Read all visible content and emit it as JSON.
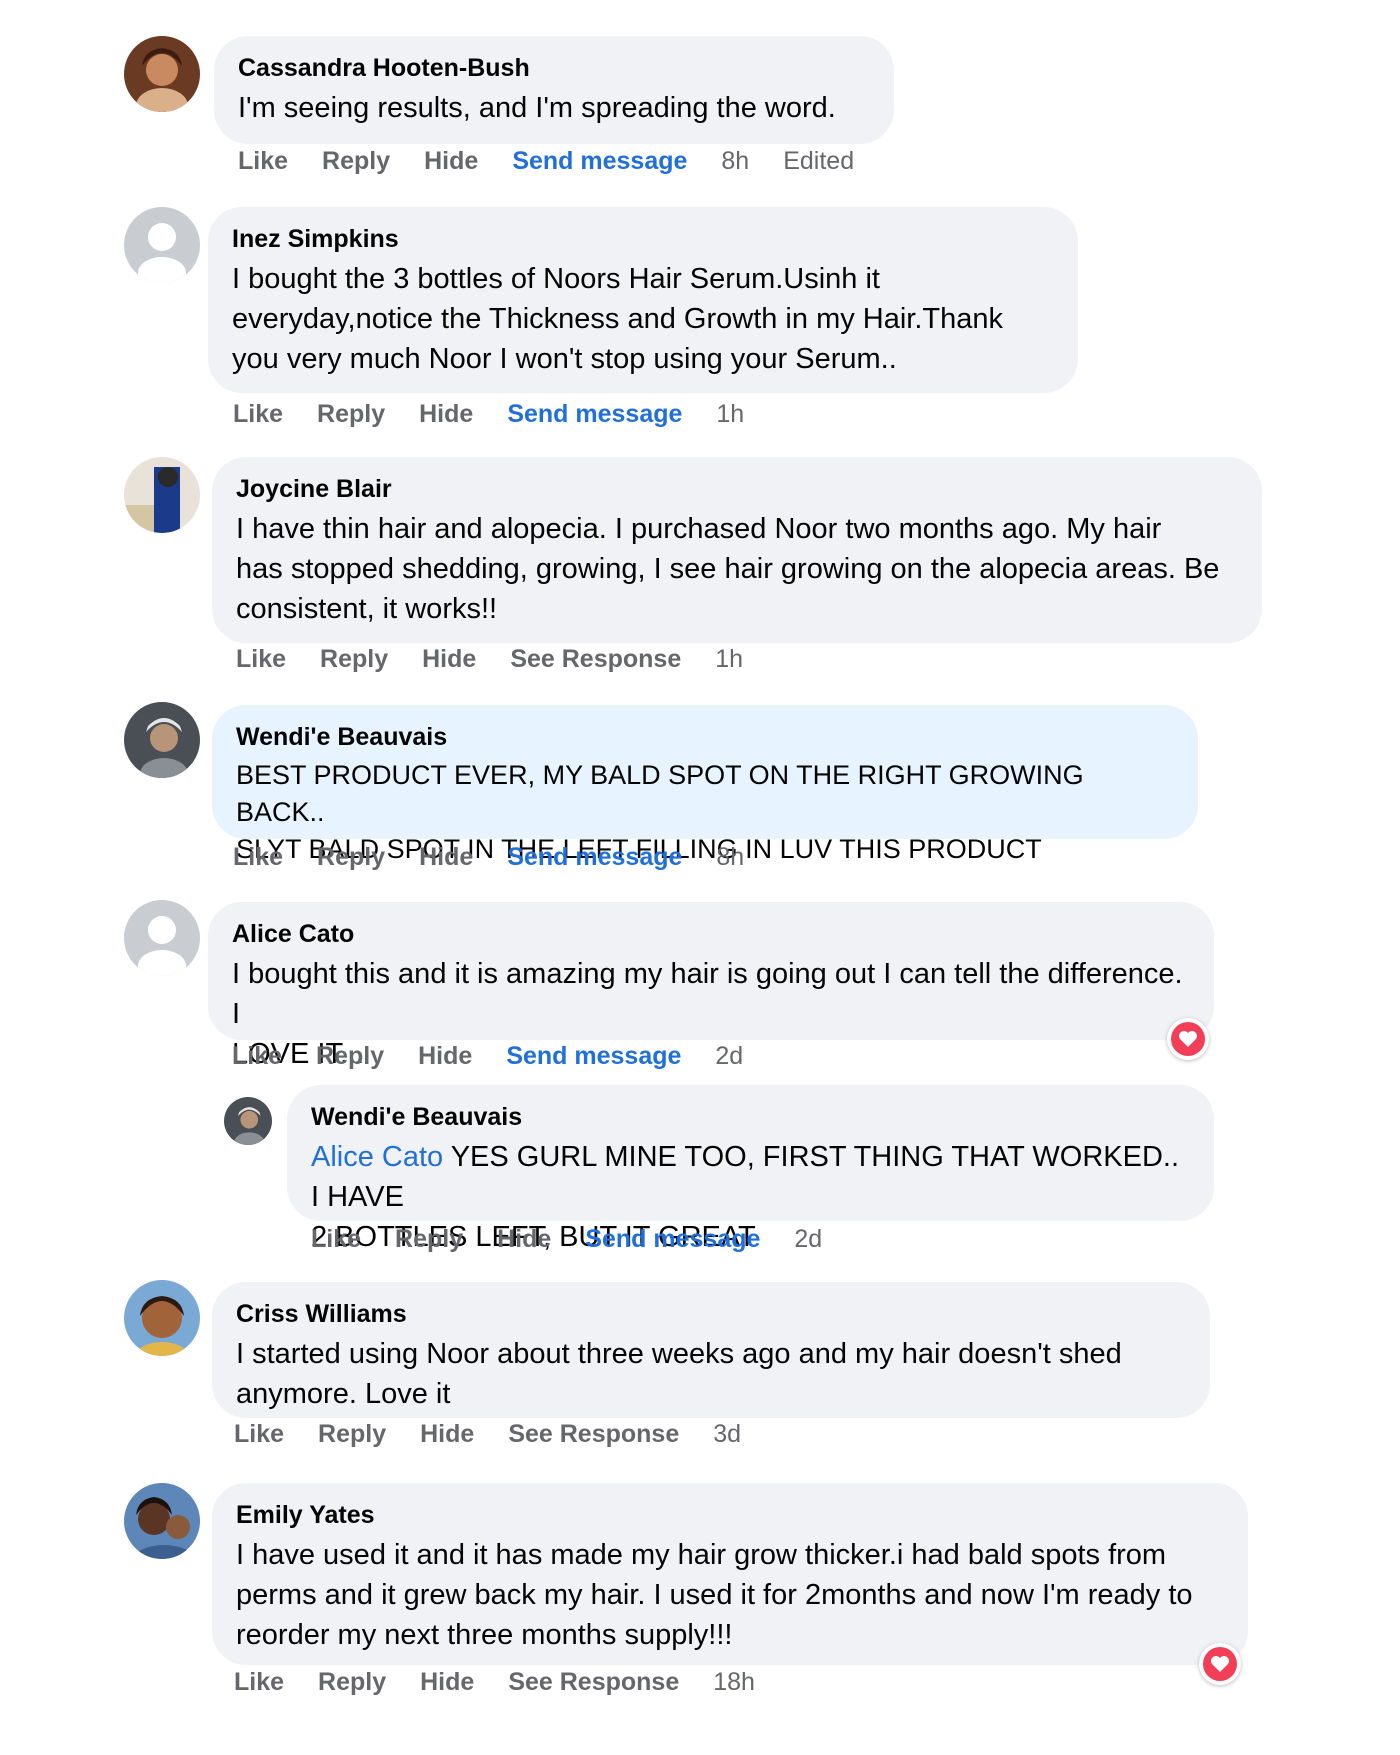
{
  "comments": [
    {
      "author": "Cassandra Hooten-Bush",
      "text": "I'm seeing results, and I'm spreading the word.",
      "actions": {
        "like": "Like",
        "reply": "Reply",
        "hide": "Hide",
        "link": "Send message",
        "time": "8h",
        "edited": "Edited"
      }
    },
    {
      "author": "Inez Simpkins",
      "text_lines": [
        "I bought the 3 bottles of Noors Hair Serum.Usinh it",
        "everyday,notice the Thickness and Growth in my Hair.Thank",
        "you very much Noor I won't stop using your Serum.."
      ],
      "actions": {
        "like": "Like",
        "reply": "Reply",
        "hide": "Hide",
        "link": "Send message",
        "time": "1h"
      }
    },
    {
      "author": "Joycine Blair",
      "text_lines": [
        "I have thin hair and alopecia. I purchased Noor two months ago. My hair",
        "has stopped shedding, growing, I see hair growing on the alopecia areas. Be",
        "consistent, it works!!"
      ],
      "actions": {
        "like": "Like",
        "reply": "Reply",
        "hide": "Hide",
        "link": "See Response",
        "time": "1h"
      }
    },
    {
      "author": "Wendi'e Beauvais",
      "text_lines": [
        "BEST PRODUCT EVER, MY BALD SPOT ON THE RIGHT GROWING BACK..",
        "SLYT BALD SPOT IN THE LEFT FILLING IN LUV THIS PRODUCT"
      ],
      "actions": {
        "like": "Like",
        "reply": "Reply",
        "hide": "Hide",
        "link": "Send message",
        "time": "8h"
      }
    },
    {
      "author": "Alice Cato",
      "text_lines": [
        "I bought this and it is amazing my hair is going out I can tell the difference. I",
        "LOVE IT..."
      ],
      "actions": {
        "like": "Like",
        "reply": "Reply",
        "hide": "Hide",
        "link": "Send message",
        "time": "2d"
      },
      "reaction": "heart"
    },
    {
      "author": "Wendi'e Beauvais",
      "mention": "Alice Cato",
      "text_lines": [
        "YES GURL MINE TOO, FIRST THING THAT WORKED.. I HAVE",
        "2 BOTTLES LEFT, BUT IT GREAT"
      ],
      "actions": {
        "like": "Like",
        "reply": "Reply",
        "hide": "Hide",
        "link": "Send message",
        "time": "2d"
      }
    },
    {
      "author": "Criss Williams",
      "text_lines": [
        "I started using Noor about three weeks ago and my hair doesn't shed",
        "anymore. Love it"
      ],
      "actions": {
        "like": "Like",
        "reply": "Reply",
        "hide": "Hide",
        "link": "See Response",
        "time": "3d"
      }
    },
    {
      "author": "Emily Yates",
      "text_lines": [
        "I have used it and it has made my hair grow thicker.i had bald spots from",
        "perms and it grew back my hair. I used it for 2months and now I'm ready to",
        "reorder my next three months supply!!!"
      ],
      "actions": {
        "like": "Like",
        "reply": "Reply",
        "hide": "Hide",
        "link": "See Response",
        "time": "18h"
      },
      "reaction": "heart"
    }
  ],
  "colors": {
    "bubble": "#f0f2f5",
    "highlight": "#e7f3ff",
    "link": "#216fdb",
    "muted": "#65676b",
    "heart": "#f33e58"
  }
}
